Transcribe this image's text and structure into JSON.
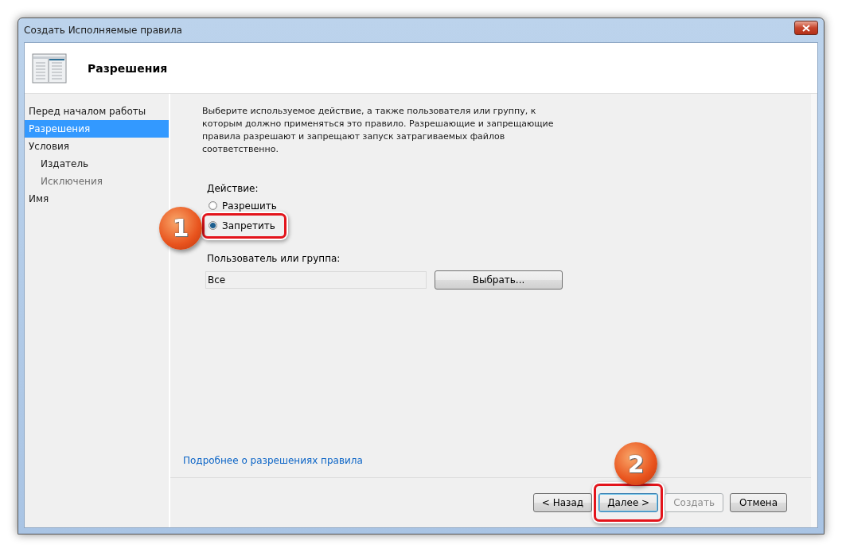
{
  "window": {
    "title": "Создать Исполняемые правила"
  },
  "header": {
    "title": "Разрешения"
  },
  "sidebar": {
    "items": [
      {
        "label": "Перед началом работы",
        "selected": false,
        "disabled": false
      },
      {
        "label": "Разрешения",
        "selected": true,
        "disabled": false
      },
      {
        "label": "Условия",
        "selected": false,
        "disabled": false,
        "children": [
          {
            "label": "Издатель",
            "selected": false,
            "disabled": false
          },
          {
            "label": "Исключения",
            "selected": false,
            "disabled": true
          }
        ]
      },
      {
        "label": "Имя",
        "selected": false,
        "disabled": false
      }
    ]
  },
  "content": {
    "description": "Выберите используемое действие, а также пользователя или группу, к которым должно применяться это правило. Разрешающие и запрещающие правила разрешают и запрещают запуск затрагиваемых файлов соответственно.",
    "action_label": "Действие:",
    "actions": [
      {
        "label": "Разрешить",
        "selected": false
      },
      {
        "label": "Запретить",
        "selected": true
      }
    ],
    "user_label": "Пользователь или группа:",
    "user_field": {
      "value": "Все"
    },
    "select_button": "Выбрать...",
    "help_link": "Подробнее о разрешениях правила"
  },
  "buttons": [
    {
      "label": "< Назад",
      "disabled": false,
      "default": false
    },
    {
      "label": "Далее >",
      "disabled": false,
      "default": true
    },
    {
      "label": "Создать",
      "disabled": true,
      "default": false
    },
    {
      "label": "Отмена",
      "disabled": false,
      "default": false
    }
  ],
  "annotations": [
    {
      "number": "1"
    },
    {
      "number": "2"
    }
  ]
}
